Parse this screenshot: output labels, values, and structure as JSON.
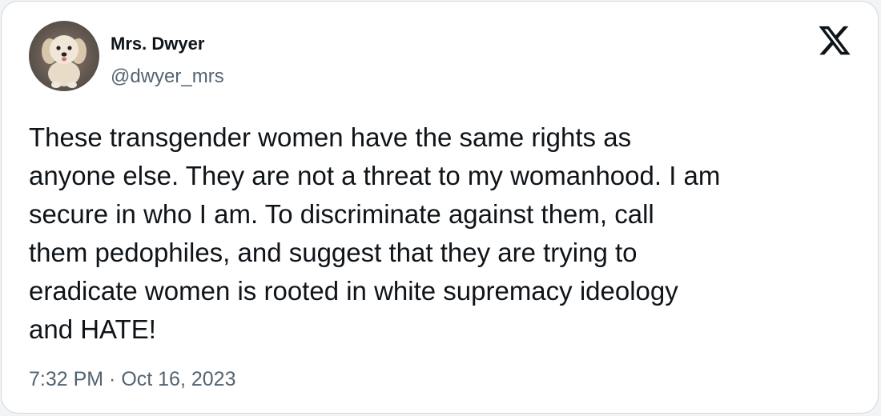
{
  "tweet": {
    "author": {
      "display_name": "Mrs. Dwyer",
      "handle": "@dwyer_mrs",
      "avatar_icon": "dog-avatar"
    },
    "brand_icon": "x-logo-icon",
    "text_lines": [
      "These transgender women have the same rights as",
      "anyone else. They are not a threat to my womanhood. I am",
      "secure in who I am. To discriminate against them, call",
      "them pedophiles, and suggest that they are trying to",
      "eradicate women is rooted in white supremacy ideology",
      "and HATE!"
    ],
    "timestamp": "7:32 PM · Oct 16, 2023"
  },
  "colors": {
    "text_primary": "#0f1419",
    "text_secondary": "#536471",
    "card_border": "#cfd9de",
    "background": "#f2f3f5"
  }
}
